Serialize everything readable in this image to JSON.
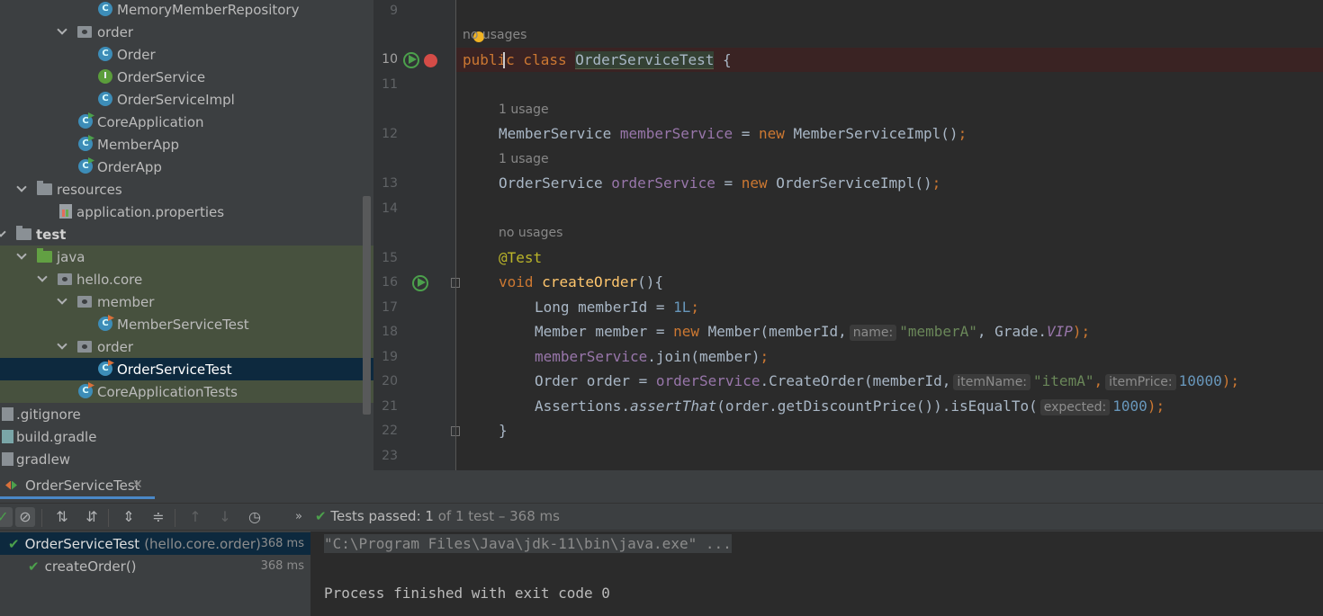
{
  "project_tree": {
    "items": [
      {
        "label": "MemoryMemberRepository",
        "icon": "class-icon",
        "kind": "class"
      },
      {
        "label": "order",
        "icon": "package-icon",
        "kind": "package"
      },
      {
        "label": "Order",
        "icon": "class-icon",
        "kind": "class"
      },
      {
        "label": "OrderService",
        "icon": "interface-icon",
        "kind": "interface"
      },
      {
        "label": "OrderServiceImpl",
        "icon": "class-icon",
        "kind": "class"
      },
      {
        "label": "CoreApplication",
        "icon": "runnable-class-icon",
        "kind": "class"
      },
      {
        "label": "MemberApp",
        "icon": "runnable-class-icon",
        "kind": "class"
      },
      {
        "label": "OrderApp",
        "icon": "runnable-class-icon",
        "kind": "class"
      },
      {
        "label": "resources",
        "icon": "resources-folder-icon",
        "kind": "folder"
      },
      {
        "label": "application.properties",
        "icon": "properties-file-icon",
        "kind": "file"
      },
      {
        "label": "test",
        "icon": "folder-icon",
        "kind": "folder"
      },
      {
        "label": "java",
        "icon": "test-source-folder-icon",
        "kind": "folder"
      },
      {
        "label": "hello.core",
        "icon": "package-icon",
        "kind": "package"
      },
      {
        "label": "member",
        "icon": "package-icon",
        "kind": "package"
      },
      {
        "label": "MemberServiceTest",
        "icon": "test-class-icon",
        "kind": "class"
      },
      {
        "label": "order",
        "icon": "package-icon",
        "kind": "package"
      },
      {
        "label": "OrderServiceTest",
        "icon": "test-class-icon",
        "kind": "class"
      },
      {
        "label": "CoreApplicationTests",
        "icon": "test-class-icon",
        "kind": "class"
      },
      {
        "label": ".gitignore",
        "icon": "file-icon",
        "kind": "file"
      },
      {
        "label": "build.gradle",
        "icon": "gradle-icon",
        "kind": "file"
      },
      {
        "label": "gradlew",
        "icon": "file-icon",
        "kind": "file"
      }
    ]
  },
  "editor": {
    "line_numbers": [
      "9",
      "10",
      "11",
      "12",
      "13",
      "14",
      "15",
      "16",
      "17",
      "18",
      "19",
      "20",
      "21",
      "22",
      "23"
    ],
    "hints": {
      "class_usages": "no usages",
      "member_service_usages": "1 usage",
      "order_service_usages": "1 usage",
      "test_usages": "no usages"
    },
    "code": {
      "l10_kw": "public class ",
      "l10_name": "OrderServiceTest",
      "l10_rest": " {",
      "l12_type": "MemberService ",
      "l12_field": "memberService",
      "l12_eq": " = ",
      "l12_new": "new ",
      "l12_ctor": "MemberServiceImpl()",
      "l12_semi": ";",
      "l13_type": "OrderService ",
      "l13_field": "orderService",
      "l13_eq": " = ",
      "l13_new": "new ",
      "l13_ctor": "OrderServiceImpl()",
      "l13_semi": ";",
      "l15_ann": "@Test",
      "l16_void": "void ",
      "l16_name": "createOrder",
      "l16_rest": "(){",
      "l17_type": "Long memberId = ",
      "l17_num": "1L",
      "l17_semi": ";",
      "l18_a": "Member member = ",
      "l18_new": "new ",
      "l18_b": "Member(memberId,",
      "l18_hint": "name:",
      "l18_str": "\"memberA\"",
      "l18_c": ", Grade.",
      "l18_vip": "VIP",
      "l18_d": ");",
      "l19_field": "memberService",
      "l19_rest": ".join(member)",
      "l19_semi": ";",
      "l20_a": "Order order = ",
      "l20_field": "orderService",
      "l20_b": ".CreateOrder(memberId,",
      "l20_hint1": "itemName:",
      "l20_str": "\"itemA\"",
      "l20_c": ",",
      "l20_hint2": "itemPrice:",
      "l20_num": "10000",
      "l20_d": ");",
      "l21_a": "Assertions.",
      "l21_method": "assertThat",
      "l21_b": "(order.getDiscountPrice()).isEqualTo(",
      "l21_hint": "expected:",
      "l21_num": "1000",
      "l21_c": ");",
      "l22": "}"
    }
  },
  "run_panel": {
    "tab_label": "OrderServiceTest",
    "status_prefix": "Tests passed:",
    "status_count": "1",
    "status_suffix": "of 1 test – 368 ms",
    "tests": [
      {
        "name": "OrderServiceTest",
        "package": "(hello.core.order)",
        "time": "368 ms"
      },
      {
        "name": "createOrder()",
        "package": "",
        "time": "368 ms"
      }
    ],
    "console": {
      "command": "\"C:\\Program Files\\Java\\jdk-11\\bin\\java.exe\" ...",
      "exit": "Process finished with exit code 0"
    }
  },
  "colors": {
    "keyword": "#cc7832",
    "field": "#9876aa",
    "string": "#6a8759",
    "number": "#6897bb",
    "annotation": "#bbb529",
    "method": "#ffc66d",
    "passed": "#4ca04c",
    "selection": "#0d293e"
  }
}
